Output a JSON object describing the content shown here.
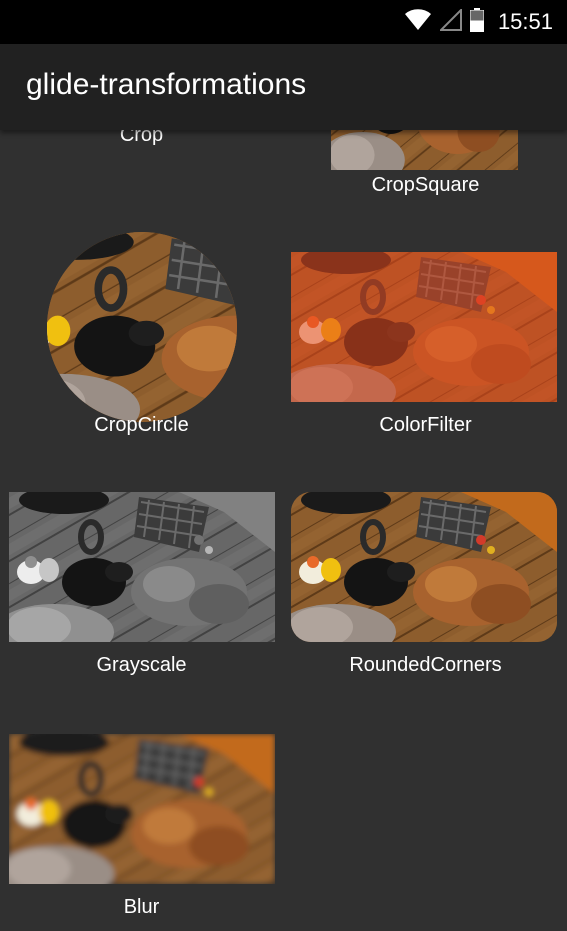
{
  "status_bar": {
    "time": "15:51",
    "icons": [
      "wifi-icon",
      "cell-signal-icon",
      "battery-icon"
    ]
  },
  "app_bar": {
    "title": "glide-transformations"
  },
  "grid": {
    "items": [
      {
        "label": "Crop"
      },
      {
        "label": "CropSquare"
      },
      {
        "label": "CropCircle"
      },
      {
        "label": "ColorFilter"
      },
      {
        "label": "Grayscale"
      },
      {
        "label": "RoundedCorners"
      },
      {
        "label": "Blur"
      }
    ]
  },
  "colors": {
    "background": "#303030",
    "app_bar": "#212121",
    "status_bar": "#000000",
    "color_filter_tint": "#e8481e"
  }
}
